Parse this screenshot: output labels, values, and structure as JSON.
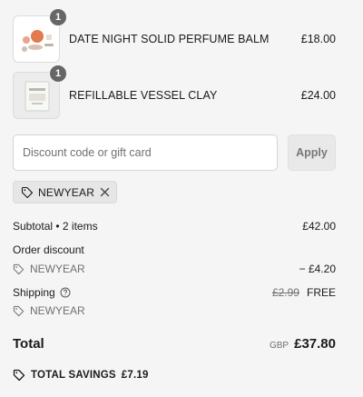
{
  "line_items": [
    {
      "name": "DATE NIGHT SOLID PERFUME BALM",
      "price": "£18.00",
      "quantity": "1",
      "image_icon": "perfume-balm-image"
    },
    {
      "name": "REFILLABLE VESSEL CLAY",
      "price": "£24.00",
      "quantity": "1",
      "image_icon": "vessel-clay-image"
    }
  ],
  "discount": {
    "placeholder": "Discount code or gift card",
    "value": "",
    "apply_label": "Apply"
  },
  "applied_code": {
    "label": "NEWYEAR",
    "icon": "tag-icon",
    "remove_icon": "close-icon"
  },
  "summary": {
    "subtotal_label": "Subtotal • 2 items",
    "subtotal_value": "£42.00",
    "order_discount_label": "Order discount",
    "order_discount_code": "NEWYEAR",
    "order_discount_value": "− £4.20",
    "shipping_label": "Shipping",
    "shipping_original": "£2.99",
    "shipping_value": "FREE",
    "shipping_code": "NEWYEAR",
    "total_label": "Total",
    "currency": "GBP",
    "total_value": "£37.80",
    "savings_label": "TOTAL SAVINGS",
    "savings_value": "£7.19"
  },
  "colors": {
    "background": "#f5f5f5",
    "badge": "#666666",
    "muted_text": "#707070",
    "apply_button_bg": "#e9e9e9"
  }
}
